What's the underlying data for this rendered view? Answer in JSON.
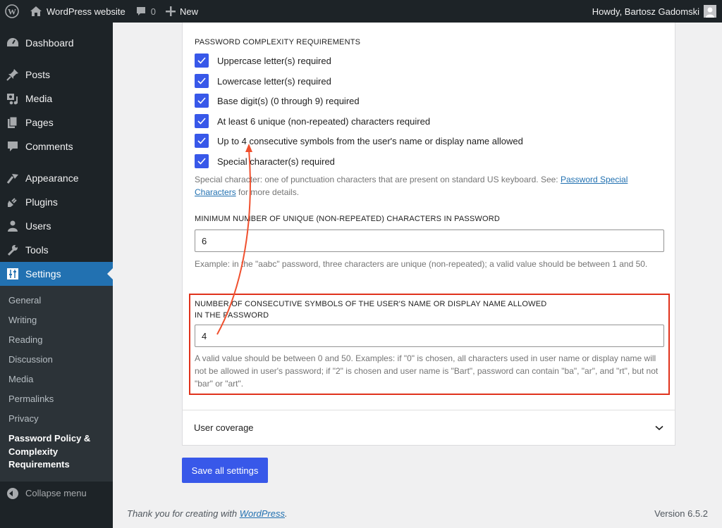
{
  "adminbar": {
    "site_name": "WordPress website",
    "comments_count": "0",
    "new_label": "New",
    "howdy": "Howdy, Bartosz Gadomski"
  },
  "sidebar": {
    "items": [
      {
        "label": "Dashboard",
        "icon": "dashboard-icon"
      },
      {
        "label": "Posts",
        "icon": "pin-icon"
      },
      {
        "label": "Media",
        "icon": "media-icon"
      },
      {
        "label": "Pages",
        "icon": "pages-icon"
      },
      {
        "label": "Comments",
        "icon": "comment-icon"
      },
      {
        "label": "Appearance",
        "icon": "brush-icon"
      },
      {
        "label": "Plugins",
        "icon": "plug-icon"
      },
      {
        "label": "Users",
        "icon": "user-icon"
      },
      {
        "label": "Tools",
        "icon": "wrench-icon"
      },
      {
        "label": "Settings",
        "icon": "sliders-icon"
      }
    ],
    "submenu": [
      "General",
      "Writing",
      "Reading",
      "Discussion",
      "Media",
      "Permalinks",
      "Privacy",
      "Password Policy & Complexity Requirements"
    ],
    "collapse_label": "Collapse menu"
  },
  "content": {
    "complexity_heading": "Password complexity requirements",
    "checkboxes": [
      {
        "label": "Uppercase letter(s) required",
        "checked": true
      },
      {
        "label": "Lowercase letter(s) required",
        "checked": true
      },
      {
        "label": "Base digit(s) (0 through 9) required",
        "checked": true
      },
      {
        "label": "At least 6 unique (non-repeated) characters required",
        "checked": true
      },
      {
        "label": "Up to 4 consecutive symbols from the user's name or display name allowed",
        "checked": true
      },
      {
        "label": "Special character(s) required",
        "checked": true
      }
    ],
    "special_help_prefix": "Special character: one of punctuation characters that are present on standard US keyboard. See: ",
    "special_help_link": "Password Special Characters",
    "special_help_suffix": " for more details.",
    "unique_label": "Minimum number of unique (non-repeated) characters in password",
    "unique_value": "6",
    "unique_help": "Example: in the \"aabc\" password, three characters are unique (non-repeated); a valid value should be between 1 and 50.",
    "consecutive_label_1": "Number of consecutive symbols of the user's name or display name allowed",
    "consecutive_label_2": "in the password",
    "consecutive_value": "4",
    "consecutive_help": "A valid value should be between 0 and 50. Examples: if \"0\" is chosen, all characters used in user name or display name will not be allowed in user's password; if \"2\" is chosen and user name is \"Bart\", password can contain \"ba\", \"ar\", and \"rt\", but not \"bar\" or \"art\".",
    "accordion_label": "User coverage",
    "save_label": "Save all settings"
  },
  "footer": {
    "thanks_prefix": "Thank you for creating with ",
    "thanks_link": "WordPress",
    "thanks_suffix": ".",
    "version": "Version 6.5.2"
  },
  "colors": {
    "accent": "#3858e9",
    "admin_blue": "#2271b1",
    "annotation_red": "#e0321c"
  }
}
